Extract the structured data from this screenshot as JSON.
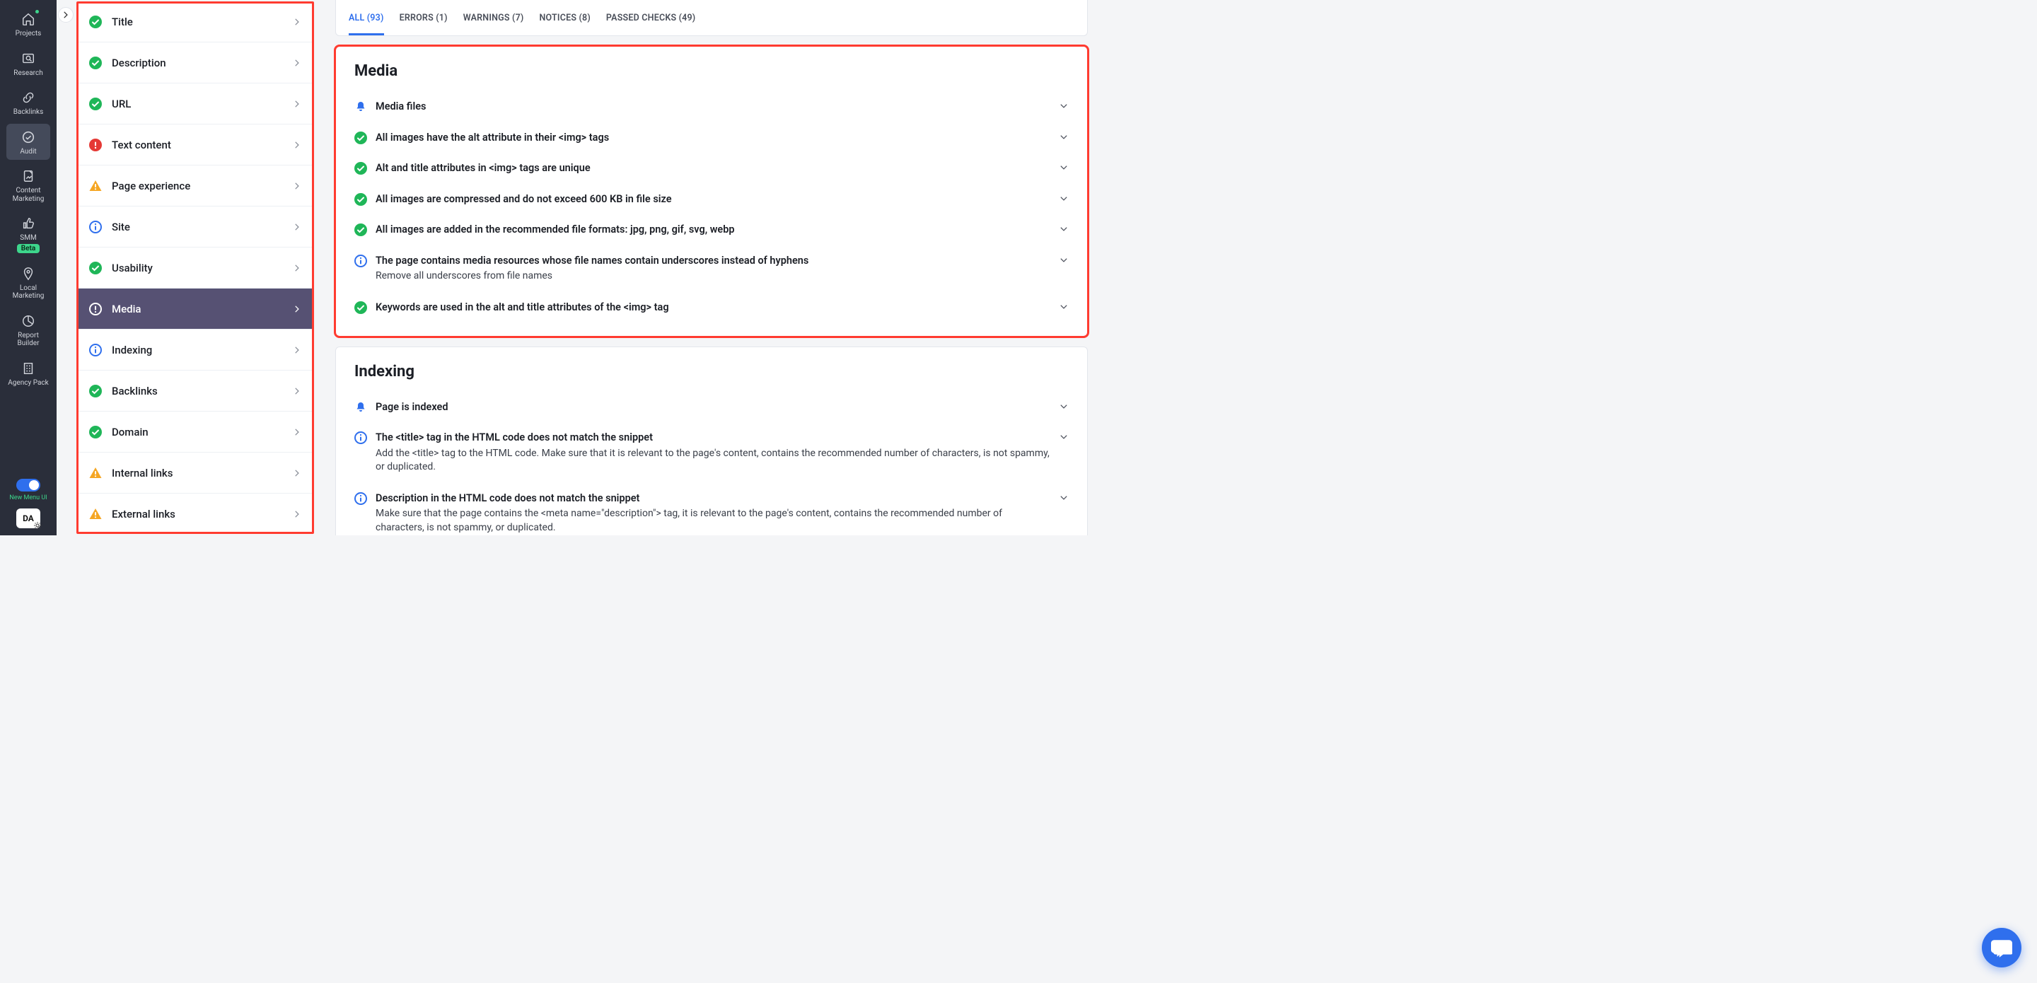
{
  "nav": {
    "items": [
      {
        "key": "projects",
        "label": "Projects",
        "icon": "home",
        "dot": true
      },
      {
        "key": "research",
        "label": "Research",
        "icon": "grid"
      },
      {
        "key": "backlinks",
        "label": "Backlinks",
        "icon": "link"
      },
      {
        "key": "audit",
        "label": "Audit",
        "icon": "check-circle",
        "active": true
      },
      {
        "key": "content",
        "label": "Content Marketing",
        "icon": "doc"
      },
      {
        "key": "smm",
        "label": "SMM",
        "icon": "thumb",
        "badge": "Beta"
      },
      {
        "key": "local",
        "label": "Local Marketing",
        "icon": "pin"
      },
      {
        "key": "report",
        "label": "Report Builder",
        "icon": "pie"
      },
      {
        "key": "agency",
        "label": "Agency Pack",
        "icon": "building"
      }
    ],
    "toggle_label": "New Menu UI",
    "da_label": "DA"
  },
  "categories": [
    {
      "key": "title",
      "label": "Title",
      "status": "pass"
    },
    {
      "key": "description",
      "label": "Description",
      "status": "pass"
    },
    {
      "key": "url",
      "label": "URL",
      "status": "pass"
    },
    {
      "key": "text",
      "label": "Text content",
      "status": "error"
    },
    {
      "key": "pagex",
      "label": "Page experience",
      "status": "warn"
    },
    {
      "key": "site",
      "label": "Site",
      "status": "notice"
    },
    {
      "key": "usability",
      "label": "Usability",
      "status": "pass"
    },
    {
      "key": "media",
      "label": "Media",
      "status": "ring",
      "active": true
    },
    {
      "key": "indexing",
      "label": "Indexing",
      "status": "notice"
    },
    {
      "key": "sbacklinks",
      "label": "Backlinks",
      "status": "pass"
    },
    {
      "key": "domain",
      "label": "Domain",
      "status": "pass"
    },
    {
      "key": "intlinks",
      "label": "Internal links",
      "status": "warn"
    },
    {
      "key": "extlinks",
      "label": "External links",
      "status": "warn"
    }
  ],
  "tabs": [
    {
      "key": "all",
      "label": "ALL (93)",
      "active": true
    },
    {
      "key": "errors",
      "label": "ERRORS (1)"
    },
    {
      "key": "warnings",
      "label": "WARNINGS (7)"
    },
    {
      "key": "notices",
      "label": "NOTICES (8)"
    },
    {
      "key": "passed",
      "label": "PASSED CHECKS (49)"
    }
  ],
  "sections": {
    "media": {
      "title": "Media",
      "checks": [
        {
          "status": "bell",
          "title": "Media files"
        },
        {
          "status": "pass",
          "title": "All images have the alt attribute in their <img> tags"
        },
        {
          "status": "pass",
          "title": "Alt and title attributes in <img> tags are unique"
        },
        {
          "status": "pass",
          "title": "All images are compressed and do not exceed 600 KB in file size"
        },
        {
          "status": "pass",
          "title": "All images are added in the recommended file formats: jpg, png, gif, svg, webp"
        },
        {
          "status": "notice",
          "title": "The page contains media resources whose file names contain underscores instead of hyphens",
          "sub": "Remove all underscores from file names"
        },
        {
          "status": "pass",
          "title": "Keywords are used in the alt and title attributes of the <img> tag"
        }
      ]
    },
    "indexing": {
      "title": "Indexing",
      "checks": [
        {
          "status": "bell",
          "title": "Page is indexed"
        },
        {
          "status": "notice",
          "title": "The <title> tag in the HTML code does not match the snippet",
          "sub": "Add the <title> tag to the HTML code. Make sure that it is relevant to the page's content, contains the recommended number of characters, is not spammy, or duplicated."
        },
        {
          "status": "notice",
          "title": "Description in the HTML code does not match the snippet",
          "sub": "Make sure that the page contains the <meta name=\"description\"> tag, it is relevant to the page's content, contains the recommended number of characters, is not spammy, or duplicated."
        }
      ]
    }
  }
}
